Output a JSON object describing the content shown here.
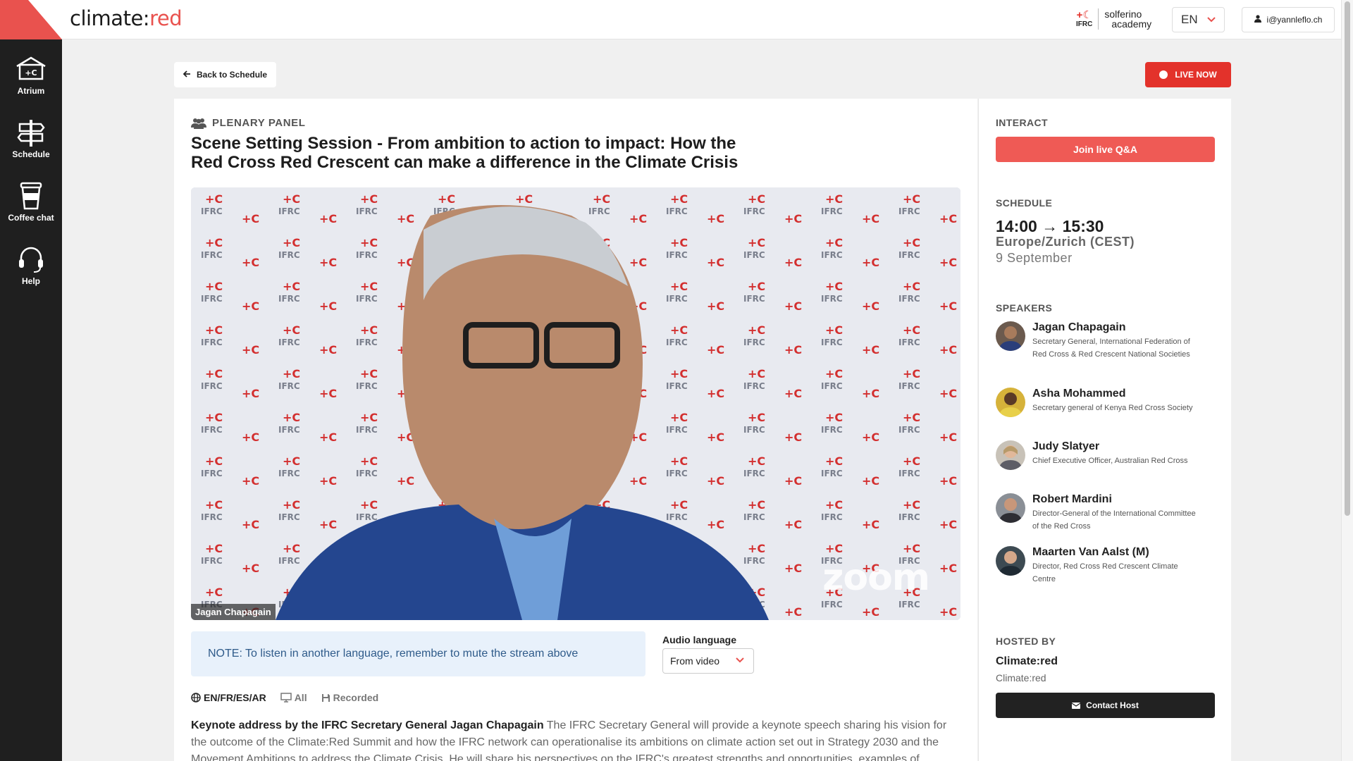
{
  "brand": {
    "name_prefix": "climate:",
    "name_accent": "red"
  },
  "header": {
    "partner_org": "IFRC",
    "partner_line1": "solferino",
    "partner_line2": "academy",
    "language": "EN",
    "user_email": "i@yannleflo.ch"
  },
  "sidebar": {
    "items": [
      {
        "label": "Atrium",
        "icon": "atrium-icon"
      },
      {
        "label": "Schedule",
        "icon": "schedule-signpost-icon"
      },
      {
        "label": "Coffee chat",
        "icon": "coffee-cup-icon"
      },
      {
        "label": "Help",
        "icon": "headset-icon"
      }
    ]
  },
  "nav": {
    "back_label": "Back to Schedule",
    "live_label": "LIVE NOW"
  },
  "session": {
    "kind": "PLENARY PANEL",
    "title": "Scene Setting Session - From ambition to action to impact: How the Red Cross Red Crescent can make a difference in the Climate Crisis",
    "video_caption": "Jagan Chapagain",
    "video_watermark": "zoom",
    "note": "NOTE: To listen in another language, remember to mute the stream above",
    "audio_label": "Audio language",
    "audio_value": "From video",
    "languages": "EN/FR/ES/AR",
    "audience": "All",
    "recording": "Recorded",
    "desc_bold": "Keynote address by the IFRC Secretary General Jagan Chapagain",
    "desc_text": " The IFRC Secretary General will provide a keynote speech sharing his vision for the outcome of the Climate:Red Summit and how the IFRC network can operationalise its ambitions on climate action set out in Strategy 2030 and the Movement Ambitions to address the Climate Crisis. He will share his perspectives on the IFRC's greatest strengths and opportunities, examples of concrete"
  },
  "side": {
    "interact_label": "INTERACT",
    "qa_label": "Join live Q&A",
    "schedule_label": "SCHEDULE",
    "time": "14:00 → 15:30",
    "timezone": "Europe/Zurich (CEST)",
    "date": "9 September",
    "speakers_label": "SPEAKERS",
    "speakers": [
      {
        "name": "Jagan Chapagain",
        "role": "Secretary General, International Federation of Red Cross & Red Crescent National Societies"
      },
      {
        "name": "Asha Mohammed",
        "role": "Secretary general of Kenya Red Cross Society"
      },
      {
        "name": "Judy Slatyer",
        "role": "Chief Executive Officer, Australian Red Cross"
      },
      {
        "name": "Robert Mardini",
        "role": "Director-General of the International Committee of the Red Cross"
      },
      {
        "name": "Maarten Van Aalst (M)",
        "role": "Director, Red Cross Red Crescent Climate Centre"
      }
    ],
    "hosted_label": "HOSTED BY",
    "host_name": "Climate:red",
    "host_sub": "Climate:red",
    "contact_label": "Contact Host"
  },
  "colors": {
    "accent": "#e9524e",
    "live": "#e3322b",
    "sidebar": "#1f1f1f",
    "note_bg": "#e8f1fb"
  }
}
